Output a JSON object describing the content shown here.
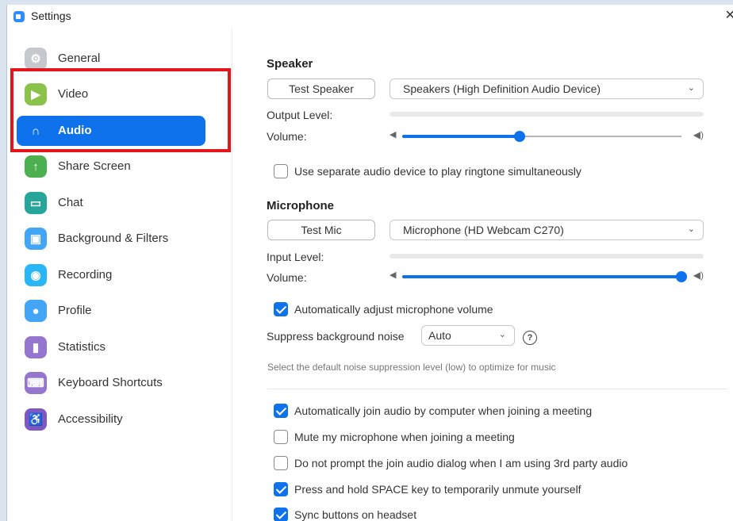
{
  "window": {
    "title": "Settings",
    "close_glyph": "✕"
  },
  "sidebar": {
    "items": [
      {
        "label": "General",
        "icon": "gear-icon",
        "color": "#c5c8cc",
        "glyph": "⚙"
      },
      {
        "label": "Video",
        "icon": "video-camera-icon",
        "color": "#8bc34a",
        "glyph": "▶"
      },
      {
        "label": "Audio",
        "icon": "headphones-icon",
        "color": "#0e72ed",
        "glyph": "∩",
        "active": true
      },
      {
        "label": "Share Screen",
        "icon": "share-screen-icon",
        "color": "#4caf50",
        "glyph": "↑"
      },
      {
        "label": "Chat",
        "icon": "chat-icon",
        "color": "#26a69a",
        "glyph": "▭"
      },
      {
        "label": "Background & Filters",
        "icon": "background-icon",
        "color": "#42a5f5",
        "glyph": "▣"
      },
      {
        "label": "Recording",
        "icon": "recording-icon",
        "color": "#29b6f6",
        "glyph": "◉"
      },
      {
        "label": "Profile",
        "icon": "profile-icon",
        "color": "#42a5f5",
        "glyph": "●"
      },
      {
        "label": "Statistics",
        "icon": "statistics-icon",
        "color": "#9575cd",
        "glyph": "▮"
      },
      {
        "label": "Keyboard Shortcuts",
        "icon": "keyboard-icon",
        "color": "#9575cd",
        "glyph": "⌨"
      },
      {
        "label": "Accessibility",
        "icon": "accessibility-icon",
        "color": "#7e57c2",
        "glyph": "♿"
      }
    ]
  },
  "speaker": {
    "title": "Speaker",
    "test_button": "Test Speaker",
    "device": "Speakers (High Definition Audio Device)",
    "output_level_label": "Output Level:",
    "volume_label": "Volume:",
    "volume_fraction": 0.42,
    "separate_device_label": "Use separate audio device to play ringtone simultaneously",
    "separate_device_checked": false
  },
  "microphone": {
    "title": "Microphone",
    "test_button": "Test Mic",
    "device": "Microphone (HD Webcam C270)",
    "input_level_label": "Input Level:",
    "volume_label": "Volume:",
    "volume_fraction": 1.0,
    "auto_adjust_label": "Automatically adjust microphone volume",
    "auto_adjust_checked": true,
    "suppress_label": "Suppress background noise",
    "suppress_value": "Auto",
    "suppress_hint": "Select the default noise suppression level (low) to optimize for music"
  },
  "options": [
    {
      "label": "Automatically join audio by computer when joining a meeting",
      "checked": true
    },
    {
      "label": "Mute my microphone when joining a meeting",
      "checked": false
    },
    {
      "label": "Do not prompt the join audio dialog when I am using 3rd party audio",
      "checked": false
    },
    {
      "label": "Press and hold SPACE key to temporarily unmute yourself",
      "checked": true
    },
    {
      "label": "Sync buttons on headset",
      "checked": true
    }
  ],
  "colors": {
    "accent": "#0e72ed",
    "highlight": "#e3161b"
  }
}
